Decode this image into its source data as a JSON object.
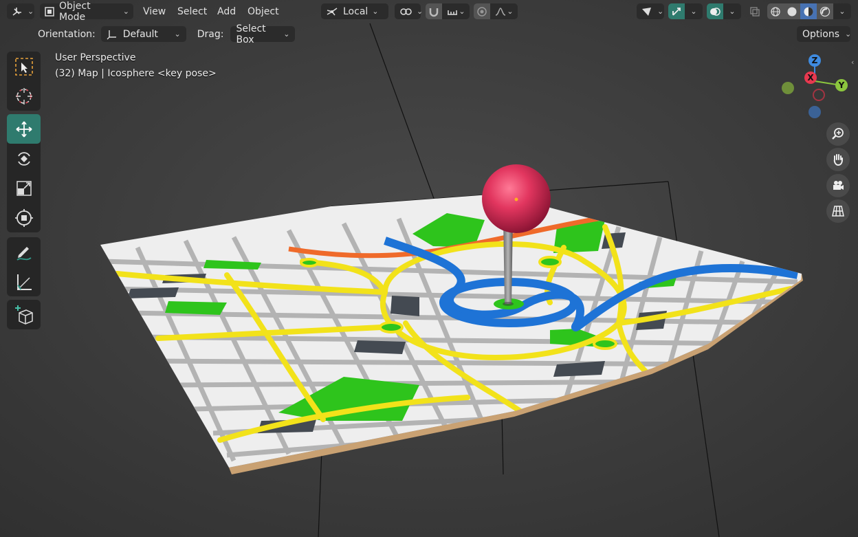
{
  "header": {
    "mode_label": "Object Mode",
    "menus": [
      "View",
      "Select",
      "Add",
      "Object"
    ],
    "transform_pivot": "Local"
  },
  "tool_settings": {
    "orientation_label": "Orientation:",
    "orientation_value": "Default",
    "drag_label": "Drag:",
    "drag_value": "Select Box",
    "options_label": "Options"
  },
  "viewport": {
    "perspective_text": "User Perspective",
    "object_info": "(32) Map | Icosphere <key pose>"
  },
  "gizmo": {
    "z": "Z",
    "x": "X",
    "y": "Y"
  },
  "toolbar": [
    {
      "name": "select-box",
      "group": 1
    },
    {
      "name": "cursor",
      "group": 1
    },
    {
      "name": "move",
      "group": 2,
      "active": true
    },
    {
      "name": "rotate",
      "group": 2
    },
    {
      "name": "scale",
      "group": 2
    },
    {
      "name": "transform",
      "group": 2
    },
    {
      "name": "annotate",
      "group": 3
    },
    {
      "name": "measure",
      "group": 3
    },
    {
      "name": "add-cube",
      "group": 4
    }
  ],
  "colors": {
    "viewport_bg": "#3a3a3a",
    "active_teal": "#2f7b6e",
    "road_yellow": "#f2e21a",
    "park_green": "#2ec41c",
    "river_blue": "#1e73d6",
    "pin_red": "#d7305a",
    "gizmo_x": "#e8384f",
    "gizmo_y": "#8cc63e",
    "gizmo_z": "#3f8be0"
  }
}
